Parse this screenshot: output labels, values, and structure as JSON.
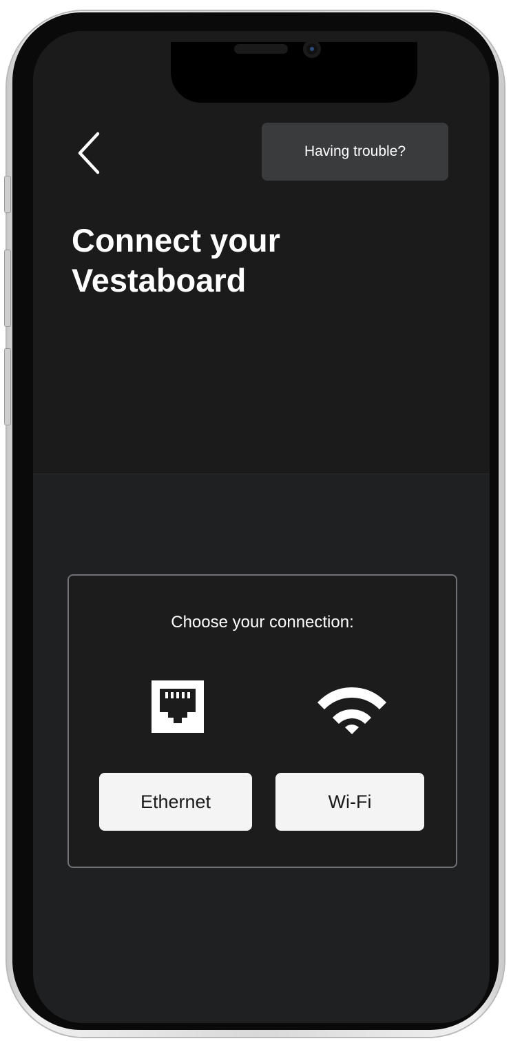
{
  "header": {
    "back_icon": "chevron-left-icon",
    "trouble_label": "Having trouble?"
  },
  "page": {
    "title_line1": "Connect your",
    "title_line2": "Vestaboard"
  },
  "connection": {
    "heading": "Choose your connection:",
    "options": [
      {
        "label": "Ethernet",
        "icon": "ethernet-port-icon"
      },
      {
        "label": "Wi-Fi",
        "icon": "wifi-icon"
      }
    ]
  },
  "colors": {
    "screen_top": "#1b1b1b",
    "screen_bottom": "#1f2022",
    "trouble_button_bg": "#3a3b3d",
    "option_button_bg": "#f4f4f4",
    "card_border": "#6f7174"
  }
}
